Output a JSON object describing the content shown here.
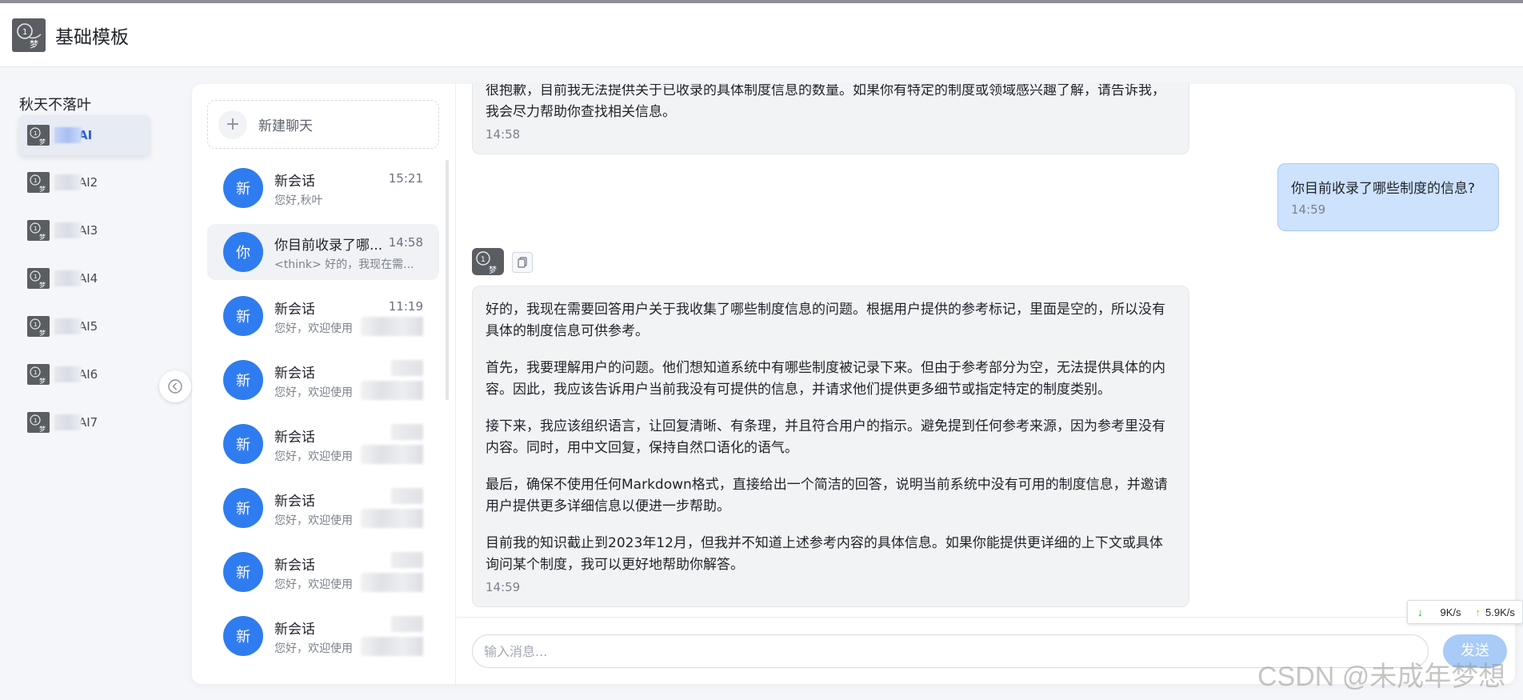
{
  "app": {
    "title": "基础模板",
    "logo_icon": "dream-logo-icon"
  },
  "sidebar": {
    "user_name": "秋天不落叶",
    "agents": [
      {
        "label": "AI",
        "active": true
      },
      {
        "label": "AI2",
        "active": false
      },
      {
        "label": "AI3",
        "active": false
      },
      {
        "label": "AI4",
        "active": false
      },
      {
        "label": "AI5",
        "active": false
      },
      {
        "label": "AI6",
        "active": false
      },
      {
        "label": "AI7",
        "active": false
      }
    ],
    "collapse_icon": "arrow-left-circle-icon"
  },
  "conversations": {
    "new_chat_icon": "+",
    "new_chat_label": "新建聊天",
    "items": [
      {
        "avatar": "新",
        "title": "新会话",
        "time": "15:21",
        "preview": "您好,秋叶"
      },
      {
        "avatar": "你",
        "title": "你目前收录了哪...",
        "time": "14:58",
        "preview": "<think> 好的，我现在需...",
        "active": true
      },
      {
        "avatar": "新",
        "title": "新会话",
        "time": "11:19",
        "preview": "您好，欢迎使用"
      },
      {
        "avatar": "新",
        "title": "新会话",
        "time": "",
        "preview": "您好，欢迎使用"
      },
      {
        "avatar": "新",
        "title": "新会话",
        "time": "",
        "preview": "您好，欢迎使用"
      },
      {
        "avatar": "新",
        "title": "新会话",
        "time": "",
        "preview": "您好，欢迎使用"
      },
      {
        "avatar": "新",
        "title": "新会话",
        "time": "",
        "preview": "您好，欢迎使用"
      },
      {
        "avatar": "新",
        "title": "新会话",
        "time": "",
        "preview": "您好，欢迎使用"
      }
    ]
  },
  "chat": {
    "messages": [
      {
        "role": "assistant",
        "paragraphs": [
          "很抱歉，目前我无法提供关于已收录的具体制度信息的数量。如果你有特定的制度或领域感兴趣了解，请告诉我，我会尽力帮助你查找相关信息。"
        ],
        "time": "14:58"
      },
      {
        "role": "user",
        "text": "你目前收录了哪些制度的信息?",
        "time": "14:59"
      },
      {
        "role": "assistant",
        "paragraphs": [
          "好的，我现在需要回答用户关于我收集了哪些制度信息的问题。根据用户提供的参考标记，里面是空的，所以没有具体的制度信息可供参考。",
          "首先，我要理解用户的问题。他们想知道系统中有哪些制度被记录下来。但由于参考部分为空，无法提供具体的内容。因此，我应该告诉用户当前我没有可提供的信息，并请求他们提供更多细节或指定特定的制度类别。",
          "接下来，我应该组织语言，让回复清晰、有条理，并且符合用户的指示。避免提到任何参考来源，因为参考里没有内容。同时，用中文回复，保持自然口语化的语气。",
          "最后，确保不使用任何Markdown格式，直接给出一个简洁的回答，说明当前系统中没有可用的制度信息，并邀请用户提供更多详细信息以便进一步帮助。",
          "目前我的知识截止到2023年12月，但我并不知道上述参考内容的具体信息。如果你能提供更详细的上下文或具体询问某个制度，我可以更好地帮助你解答。"
        ],
        "time": "14:59"
      }
    ],
    "copy_icon": "copy-icon",
    "input_placeholder": "输入消息...",
    "send_label": "发送"
  },
  "net_speed": {
    "down": "9K/s",
    "up": "5.9K/s"
  },
  "watermark": "CSDN @未成年梦想"
}
